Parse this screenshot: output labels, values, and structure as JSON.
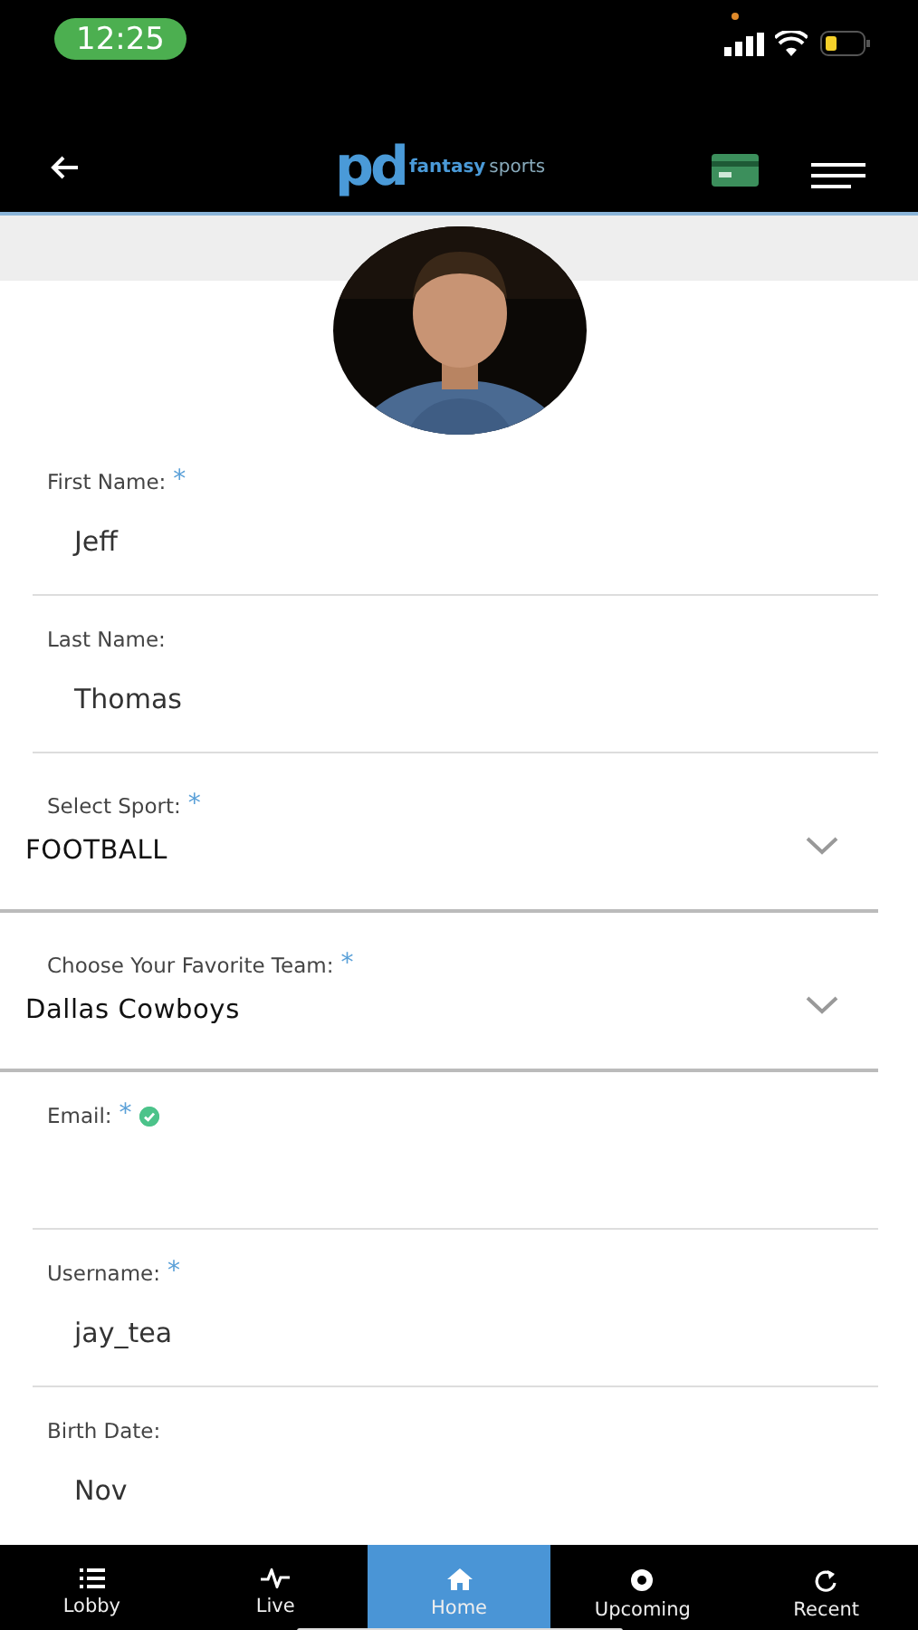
{
  "status_bar": {
    "time": "12:25"
  },
  "header": {
    "logo": {
      "mark": "pd",
      "word_1": "fantasy",
      "word_2": "sports"
    }
  },
  "fields": [
    {
      "kind": "text",
      "label": "First Name:",
      "required_mark": "*",
      "value": "Jeff"
    },
    {
      "kind": "text",
      "label": "Last Name:",
      "value": "Thomas"
    },
    {
      "kind": "select",
      "label": "Select Sport:",
      "required_mark": "*",
      "value": "FOOTBALL"
    },
    {
      "kind": "select",
      "label": "Choose Your Favorite Team:",
      "required_mark": "*",
      "value": "Dallas Cowboys"
    },
    {
      "kind": "text",
      "label": "Email:",
      "required_mark": "*",
      "verified": true
    },
    {
      "kind": "text",
      "label": "Username:",
      "required_mark": "*",
      "value": "jay_tea"
    },
    {
      "kind": "date",
      "label": "Birth Date:",
      "value": "Nov"
    }
  ],
  "tabs": [
    {
      "label": "Lobby",
      "selected": false
    },
    {
      "label": "Live",
      "selected": false
    },
    {
      "label": "Home",
      "selected": true
    },
    {
      "label": "Upcoming",
      "selected": false
    },
    {
      "label": "Recent",
      "selected": false
    }
  ]
}
